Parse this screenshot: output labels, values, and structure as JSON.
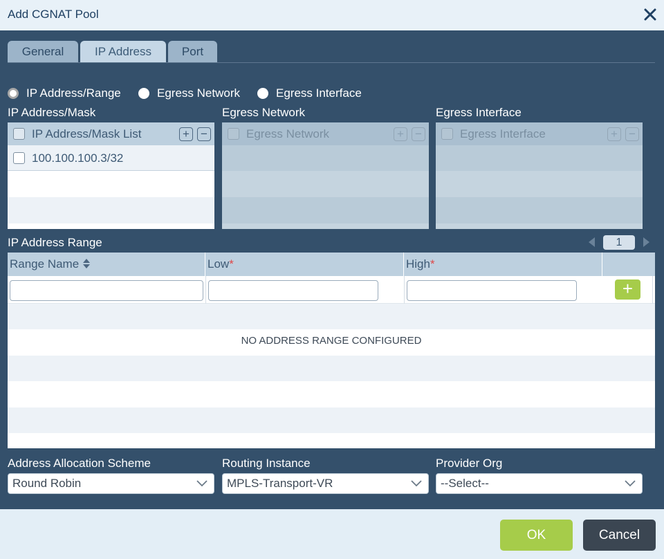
{
  "dialog": {
    "title": "Add CGNAT Pool"
  },
  "tabs": [
    {
      "label": "General"
    },
    {
      "label": "IP Address"
    },
    {
      "label": "Port"
    }
  ],
  "radios": [
    {
      "label": "IP Address/Range",
      "checked": true
    },
    {
      "label": "Egress Network",
      "checked": false
    },
    {
      "label": "Egress Interface",
      "checked": false
    }
  ],
  "ip_mask": {
    "section_label": "IP Address/Mask",
    "header": "IP Address/Mask List",
    "rows": [
      "100.100.100.3/32"
    ]
  },
  "egress_network": {
    "section_label": "Egress Network",
    "header": "Egress Network"
  },
  "egress_interface": {
    "section_label": "Egress Interface",
    "header": "Egress Interface"
  },
  "ip_range": {
    "section_label": "IP Address Range",
    "page": "1",
    "columns": {
      "name": "Range Name",
      "low": "Low",
      "high": "High",
      "required_mark": "*"
    },
    "empty_message": "NO ADDRESS RANGE CONFIGURED",
    "add_label": "+"
  },
  "allocation": {
    "label": "Address Allocation Scheme",
    "value": "Round Robin"
  },
  "routing": {
    "label": "Routing Instance",
    "value": "MPLS-Transport-VR"
  },
  "provider": {
    "label": "Provider Org",
    "value": "--Select--"
  },
  "footer": {
    "ok_label": "OK",
    "cancel_label": "Cancel"
  },
  "colors": {
    "header_bg": "#e8f1f8",
    "body_bg": "#34506b",
    "accent_green": "#a6cc4a",
    "cancel_bg": "#3b4652"
  }
}
